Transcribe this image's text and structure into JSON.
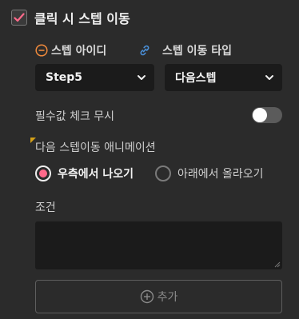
{
  "header": {
    "checked": true,
    "title": "클릭 시 스텝 이동"
  },
  "fields": {
    "step_id_label": "스텝 아이디",
    "step_move_type_label": "스텝 이동 타입",
    "step_id_value": "Step5",
    "step_move_type_value": "다음스텝"
  },
  "ignore_required": {
    "label": "필수값 체크 무시",
    "enabled": false
  },
  "animation": {
    "label": "다음 스텝이동 애니메이션",
    "options": [
      "우측에서 나오기",
      "아래에서 올라오기"
    ],
    "selected": "우측에서 나오기"
  },
  "condition": {
    "label": "조건",
    "value": ""
  },
  "add_button": {
    "label": "추가"
  },
  "colors": {
    "background": "#2b2b2b",
    "accent_pink": "#ff6a8b",
    "minus_orange": "#f08a3c",
    "link_blue": "#4a90d9",
    "field_bg": "#1b1b1b",
    "corner_yellow": "#d4a017"
  }
}
